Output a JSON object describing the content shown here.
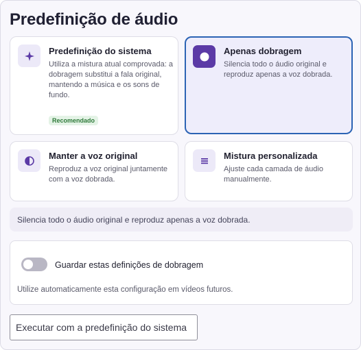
{
  "title": "Predefinição de áudio",
  "accent_color": "#5b3aa6",
  "selected_border_color": "#2b63b4",
  "options": [
    {
      "icon": "sparkle-icon",
      "title": "Predefinição do sistema",
      "description": "Utiliza a mistura atual comprovada: a dobragem substitui a fala original, mantendo a música e os sons de fundo.",
      "badge": "Recomendado",
      "selected": false
    },
    {
      "icon": "circle-icon",
      "title": "Apenas dobragem",
      "description": "Silencia todo o áudio original e reproduz apenas a voz dobrada.",
      "selected": true
    },
    {
      "icon": "half-circle-icon",
      "title": "Manter a voz original",
      "description": "Reproduz a voz original juntamente com a voz dobrada.",
      "selected": false
    },
    {
      "icon": "menu-lines-icon",
      "title": "Mistura personalizada",
      "description": "Ajuste cada camada de áudio manualmente.",
      "selected": false
    }
  ],
  "selected_description": "Silencia todo o áudio original e reproduz apenas a voz dobrada.",
  "save": {
    "label": "Guardar estas definições de dobragem",
    "hint": "Utilize automaticamente esta configuração em vídeos futuros.",
    "enabled": false
  },
  "run_button": "Executar com a predefinição do sistema"
}
